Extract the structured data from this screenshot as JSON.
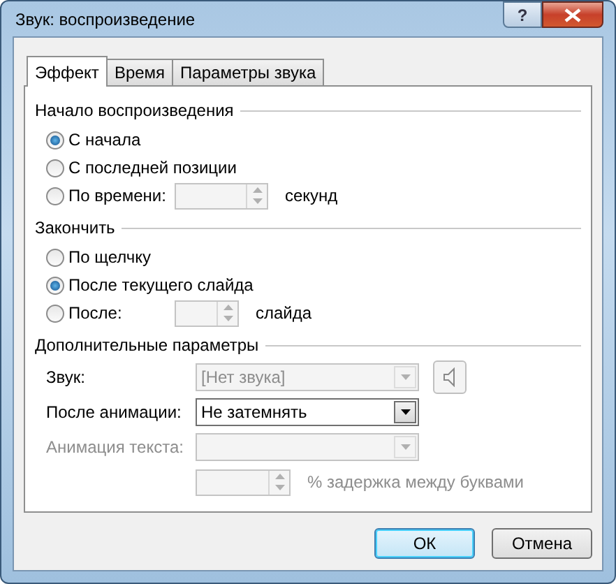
{
  "window": {
    "title": "Звук: воспроизведение",
    "help": "?"
  },
  "tabs": [
    {
      "label": "Эффект",
      "selected": true
    },
    {
      "label": "Время",
      "selected": false
    },
    {
      "label": "Параметры звука",
      "selected": false
    }
  ],
  "groups": [
    {
      "title": "Начало воспроизведения",
      "options": [
        {
          "label": "С начала",
          "selected": true,
          "kind": "plain"
        },
        {
          "label": "С последней позиции",
          "selected": false,
          "kind": "plain"
        },
        {
          "label": "По времени:",
          "selected": false,
          "kind": "spin",
          "suffix": "секунд"
        }
      ]
    },
    {
      "title": "Закончить",
      "options": [
        {
          "label": "По щелчку",
          "selected": false,
          "kind": "plain"
        },
        {
          "label": "После текущего слайда",
          "selected": true,
          "kind": "plain"
        },
        {
          "label": "После:",
          "selected": false,
          "kind": "spin",
          "suffix": "слайда"
        }
      ]
    }
  ],
  "extra": {
    "title": "Дополнительные параметры",
    "rows": [
      {
        "kind": "combo",
        "label": "Звук:",
        "label_disabled": false,
        "value": "[Нет звука]",
        "disabled": true,
        "volume_button": true
      },
      {
        "kind": "combo",
        "label": "После анимации:",
        "label_disabled": false,
        "value": "Не затемнять",
        "disabled": false
      },
      {
        "kind": "combo",
        "label": "Анимация текста:",
        "label_disabled": true,
        "disabled": true
      },
      {
        "kind": "spin",
        "suffix": "% задержка между буквами",
        "disabled": true
      }
    ]
  },
  "buttons": [
    {
      "label": "ОК",
      "default": true
    },
    {
      "label": "Отмена",
      "default": false
    }
  ]
}
